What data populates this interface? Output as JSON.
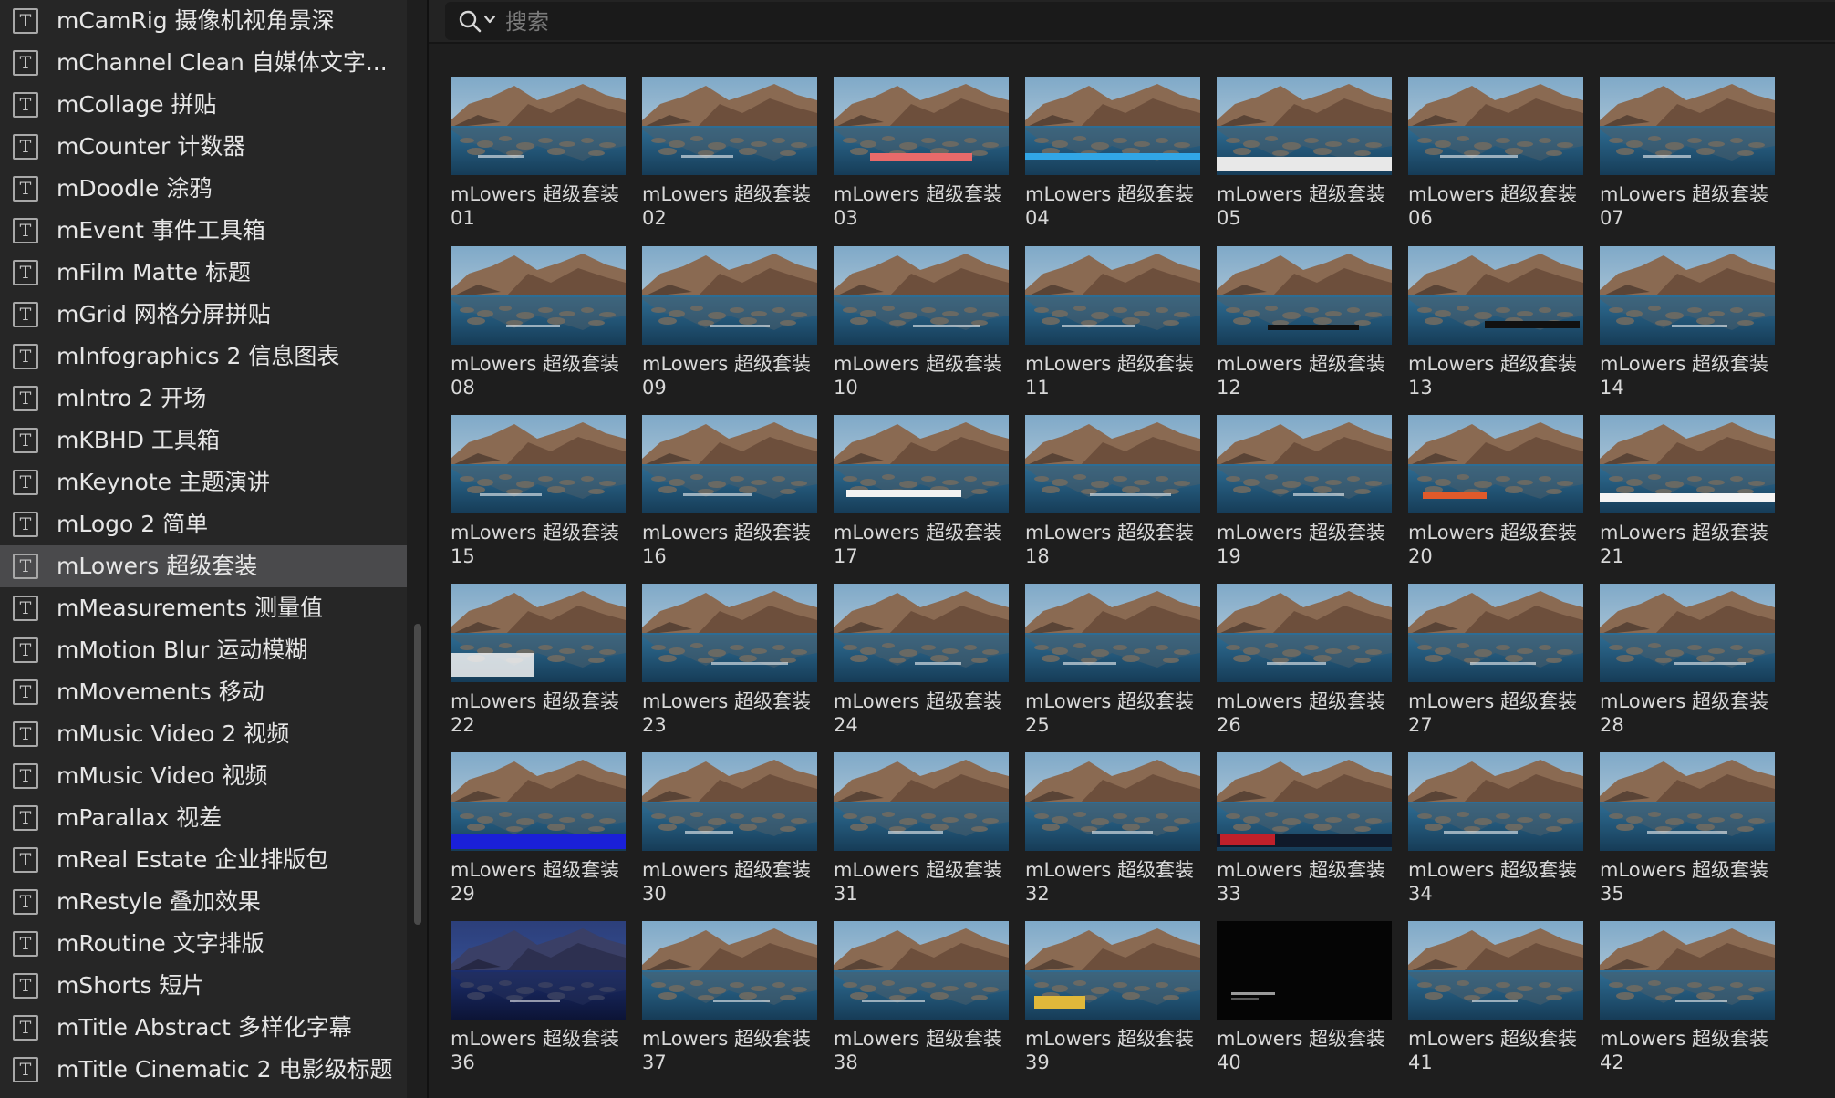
{
  "sidebar": {
    "items": [
      {
        "label": "mCamRig 摄像机视角景深",
        "selected": false
      },
      {
        "label": "mChannel Clean 自媒体文字...",
        "selected": false
      },
      {
        "label": "mCollage 拼贴",
        "selected": false
      },
      {
        "label": "mCounter 计数器",
        "selected": false
      },
      {
        "label": "mDoodle 涂鸦",
        "selected": false
      },
      {
        "label": "mEvent 事件工具箱",
        "selected": false
      },
      {
        "label": "mFilm Matte 标题",
        "selected": false
      },
      {
        "label": "mGrid 网格分屏拼贴",
        "selected": false
      },
      {
        "label": "mInfographics 2 信息图表",
        "selected": false
      },
      {
        "label": "mIntro 2 开场",
        "selected": false
      },
      {
        "label": "mKBHD 工具箱",
        "selected": false
      },
      {
        "label": "mKeynote 主题演讲",
        "selected": false
      },
      {
        "label": "mLogo 2 简单",
        "selected": false
      },
      {
        "label": "mLowers 超级套装",
        "selected": true
      },
      {
        "label": "mMeasurements 测量值",
        "selected": false
      },
      {
        "label": "mMotion Blur 运动模糊",
        "selected": false
      },
      {
        "label": "mMovements 移动",
        "selected": false
      },
      {
        "label": "mMusic Video 2 视频",
        "selected": false
      },
      {
        "label": "mMusic Video 视频",
        "selected": false
      },
      {
        "label": "mParallax 视差",
        "selected": false
      },
      {
        "label": "mReal Estate 企业排版包",
        "selected": false
      },
      {
        "label": "mRestyle 叠加效果",
        "selected": false
      },
      {
        "label": "mRoutine 文字排版",
        "selected": false
      },
      {
        "label": "mShorts 短片",
        "selected": false
      },
      {
        "label": "mTitle Abstract 多样化字幕",
        "selected": false
      },
      {
        "label": "mTitle Cinematic 2 电影级标题",
        "selected": false
      }
    ]
  },
  "search": {
    "placeholder": "搜索",
    "value": ""
  },
  "grid": {
    "tiles": [
      {
        "label": "mLowers 超级套装 01"
      },
      {
        "label": "mLowers 超级套装 02"
      },
      {
        "label": "mLowers 超级套装 03"
      },
      {
        "label": "mLowers 超级套装 04"
      },
      {
        "label": "mLowers 超级套装 05"
      },
      {
        "label": "mLowers 超级套装 06"
      },
      {
        "label": "mLowers 超级套装 07"
      },
      {
        "label": "mLowers 超级套装 08"
      },
      {
        "label": "mLowers 超级套装 09"
      },
      {
        "label": "mLowers 超级套装 10"
      },
      {
        "label": "mLowers 超级套装 11"
      },
      {
        "label": "mLowers 超级套装 12"
      },
      {
        "label": "mLowers 超级套装 13"
      },
      {
        "label": "mLowers 超级套装 14"
      },
      {
        "label": "mLowers 超级套装 15"
      },
      {
        "label": "mLowers 超级套装 16"
      },
      {
        "label": "mLowers 超级套装 17"
      },
      {
        "label": "mLowers 超级套装 18"
      },
      {
        "label": "mLowers 超级套装 19"
      },
      {
        "label": "mLowers 超级套装 20"
      },
      {
        "label": "mLowers 超级套装 21"
      },
      {
        "label": "mLowers 超级套装 22"
      },
      {
        "label": "mLowers 超级套装 23"
      },
      {
        "label": "mLowers 超级套装 24"
      },
      {
        "label": "mLowers 超级套装 25"
      },
      {
        "label": "mLowers 超级套装 26"
      },
      {
        "label": "mLowers 超级套装 27"
      },
      {
        "label": "mLowers 超级套装 28"
      },
      {
        "label": "mLowers 超级套装 29"
      },
      {
        "label": "mLowers 超级套装 30"
      },
      {
        "label": "mLowers 超级套装 31"
      },
      {
        "label": "mLowers 超级套装 32"
      },
      {
        "label": "mLowers 超级套装 33"
      },
      {
        "label": "mLowers 超级套装 34"
      },
      {
        "label": "mLowers 超级套装 35"
      },
      {
        "label": "mLowers 超级套装 36"
      },
      {
        "label": "mLowers 超级套装 37"
      },
      {
        "label": "mLowers 超级套装 38"
      },
      {
        "label": "mLowers 超级套装 39"
      },
      {
        "label": "mLowers 超级套装 40"
      },
      {
        "label": "mLowers 超级套装 41"
      },
      {
        "label": "mLowers 超级套装 42"
      }
    ]
  },
  "colors": {
    "background": "#1e1e1e",
    "sidebar": "#262626",
    "selection": "#4a4a4c",
    "text": "#e6e6e6"
  }
}
